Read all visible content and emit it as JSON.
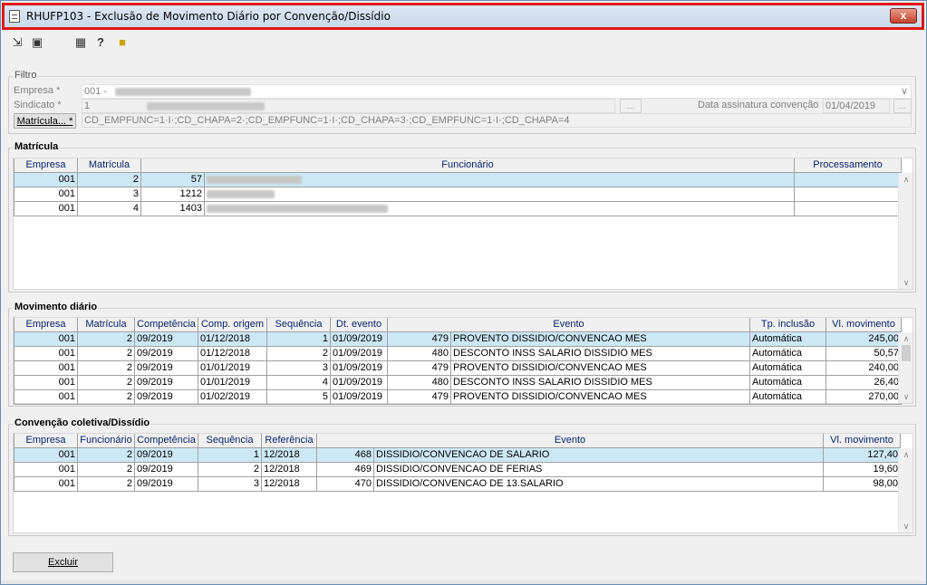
{
  "window": {
    "title": "RHUFP103 - Exclusão de Movimento Diário por Convenção/Dissídio",
    "close_label": "x"
  },
  "toolbar": {
    "icons": [
      "navigate-icon",
      "layout-icon",
      "grid-icon",
      "help-icon",
      "exit-door-icon"
    ]
  },
  "filtro": {
    "title": "Filtro",
    "empresa_label": "Empresa *",
    "empresa_value": "001 -",
    "sindicato_label": "Sindicato *",
    "sindicato_value": "1",
    "data_label": "Data assinatura convenção",
    "data_value": "01/04/2019",
    "matricula_button": "Matrícula... *",
    "matricula_value": "CD_EMPFUNC=1·I·;CD_CHAPA=2·;CD_EMPFUNC=1·I·;CD_CHAPA=3·;CD_EMPFUNC=1·I·;CD_CHAPA=4"
  },
  "matricula": {
    "title": "Matrícula",
    "columns": [
      "Empresa",
      "Matrícula",
      "Funcionário",
      "Processamento"
    ],
    "rows": [
      {
        "empresa": "001",
        "matricula": "2",
        "func_code": "57",
        "processamento": ""
      },
      {
        "empresa": "001",
        "matricula": "3",
        "func_code": "1212",
        "processamento": ""
      },
      {
        "empresa": "001",
        "matricula": "4",
        "func_code": "1403",
        "processamento": ""
      }
    ]
  },
  "movimento": {
    "title": "Movimento diário",
    "columns": [
      "Empresa",
      "Matrícula",
      "Competência",
      "Comp. origem",
      "Sequência",
      "Dt. evento",
      "Evento",
      "Tp. inclusão",
      "Vl. movimento"
    ],
    "rows": [
      {
        "empresa": "001",
        "matricula": "2",
        "competencia": "09/2019",
        "comp_origem": "01/12/2018",
        "sequencia": "1",
        "dt_evento": "01/09/2019",
        "evento_cod": "479",
        "evento": "PROVENTO DISSIDIO/CONVENCAO MES",
        "tp_inclusao": "Automática",
        "valor": "245,00"
      },
      {
        "empresa": "001",
        "matricula": "2",
        "competencia": "09/2019",
        "comp_origem": "01/12/2018",
        "sequencia": "2",
        "dt_evento": "01/09/2019",
        "evento_cod": "480",
        "evento": "DESCONTO INSS SALARIO DISSIDIO MES",
        "tp_inclusao": "Automática",
        "valor": "50,57"
      },
      {
        "empresa": "001",
        "matricula": "2",
        "competencia": "09/2019",
        "comp_origem": "01/01/2019",
        "sequencia": "3",
        "dt_evento": "01/09/2019",
        "evento_cod": "479",
        "evento": "PROVENTO DISSIDIO/CONVENCAO MES",
        "tp_inclusao": "Automática",
        "valor": "240,00"
      },
      {
        "empresa": "001",
        "matricula": "2",
        "competencia": "09/2019",
        "comp_origem": "01/01/2019",
        "sequencia": "4",
        "dt_evento": "01/09/2019",
        "evento_cod": "480",
        "evento": "DESCONTO INSS SALARIO DISSIDIO MES",
        "tp_inclusao": "Automática",
        "valor": "26,40"
      },
      {
        "empresa": "001",
        "matricula": "2",
        "competencia": "09/2019",
        "comp_origem": "01/02/2019",
        "sequencia": "5",
        "dt_evento": "01/09/2019",
        "evento_cod": "479",
        "evento": "PROVENTO DISSIDIO/CONVENCAO MES",
        "tp_inclusao": "Automática",
        "valor": "270,00"
      }
    ]
  },
  "convencao": {
    "title": "Convenção coletiva/Dissídio",
    "columns": [
      "Empresa",
      "Funcionário",
      "Competência",
      "Sequência",
      "Referência",
      "Evento",
      "Vl. movimento"
    ],
    "rows": [
      {
        "empresa": "001",
        "funcionario": "2",
        "competencia": "09/2019",
        "sequencia": "1",
        "referencia": "12/2018",
        "evento_cod": "468",
        "evento": "DISSIDIO/CONVENCAO DE SALARIO",
        "valor": "127,40"
      },
      {
        "empresa": "001",
        "funcionario": "2",
        "competencia": "09/2019",
        "sequencia": "2",
        "referencia": "12/2018",
        "evento_cod": "469",
        "evento": "DISSIDIO/CONVENCAO DE FERIAS",
        "valor": "19,60"
      },
      {
        "empresa": "001",
        "funcionario": "2",
        "competencia": "09/2019",
        "sequencia": "3",
        "referencia": "12/2018",
        "evento_cod": "470",
        "evento": "DISSIDIO/CONVENCAO DE 13.SALARIO",
        "valor": "98,00"
      }
    ]
  },
  "actions": {
    "excluir_label": "Excluir"
  },
  "colors": {
    "selected_row": "#cce8f6",
    "header_text": "#0a246a",
    "title_highlight": "#e01818"
  }
}
